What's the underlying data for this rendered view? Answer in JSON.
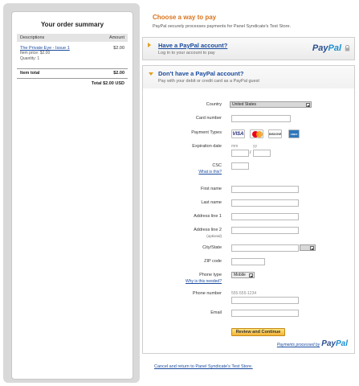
{
  "summary": {
    "title": "Your order summary",
    "col_desc": "Descriptions",
    "col_amount": "Amount",
    "item": {
      "name": "The Private Eye - Issue 1",
      "price": "$2.00",
      "item_price": "Item price: $2.00",
      "quantity": "Quantity: 1"
    },
    "item_total_label": "Item total",
    "item_total_value": "$2.00",
    "grand_total": "Total $2.00 USD"
  },
  "header": {
    "title": "Choose a way to pay",
    "subtitle": "PayPal securely processes payments for Panel Syndicate's Test Store."
  },
  "have_account": {
    "title": "Have a PayPal account?",
    "subtitle": "Log in to your account to pay",
    "logo_text_a": "Pay",
    "logo_text_b": "Pal"
  },
  "guest": {
    "title": "Don't have a PayPal account?",
    "subtitle": "Pay with your debit or credit card as a PayPal guest",
    "country_label": "Country",
    "country_value": "United States",
    "card_number_label": "Card number",
    "card_number_value": "",
    "payment_types_label": "Payment Types",
    "cards": [
      "VISA",
      "MasterCard",
      "DISCOVER",
      "AMEX"
    ],
    "expiration_label": "Expiration date",
    "exp_month_hint": "mm",
    "exp_year_hint": "yy",
    "exp_sep": "/",
    "csc_label": "CSC",
    "csc_help": "What is this?",
    "first_name_label": "First name",
    "last_name_label": "Last name",
    "address1_label": "Address line 1",
    "address2_label": "Address line 2",
    "address2_note": "(optional)",
    "city_state_label": "City/State",
    "state_value": "",
    "zip_label": "ZIP code",
    "phone_type_label": "Phone type",
    "phone_type_help": "Why is this needed?",
    "phone_type_value": "Mobile",
    "phone_number_label": "Phone number",
    "phone_placeholder": "555-555-1234",
    "email_label": "Email",
    "review_button": "Review and Continue",
    "processed_by": "Payments processed by",
    "processed_logo_a": "Pay",
    "processed_logo_b": "Pal"
  },
  "footer": {
    "cancel_link": "Cancel and return to Panel Syndicate's Test Store."
  }
}
